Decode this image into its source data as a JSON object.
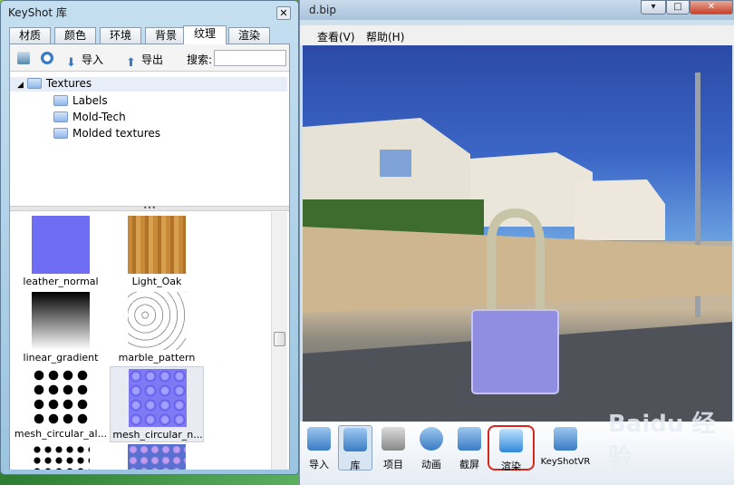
{
  "library": {
    "title": "KeyShot 库",
    "tabs": [
      "材质",
      "颜色",
      "环境",
      "背景",
      "纹理",
      "渲染"
    ],
    "active_tab": "纹理",
    "toolbar": {
      "import_label": "导入",
      "export_label": "导出",
      "search_label": "搜索:",
      "search_value": ""
    },
    "tree": {
      "root": "Textures",
      "children": [
        "Labels",
        "Mold-Tech",
        "Molded textures"
      ]
    },
    "thumbnails": [
      {
        "name": "leather_normal",
        "icon": "leather-normal-swatch"
      },
      {
        "name": "Light_Oak",
        "icon": "oak-wood-swatch"
      },
      {
        "name": "linear_gradient",
        "icon": "gradient-swatch"
      },
      {
        "name": "marble_pattern",
        "icon": "marble-swatch"
      },
      {
        "name": "mesh_circular_al...",
        "icon": "circle-mesh-swatch"
      },
      {
        "name": "mesh_circular_n...",
        "icon": "circle-normal-swatch"
      }
    ]
  },
  "main": {
    "title_fragment": "d.bip",
    "menu": [
      "查看(V)",
      "帮助(H)"
    ],
    "toolbar": [
      "导入",
      "库",
      "项目",
      "动画",
      "截屏",
      "渲染",
      "KeyShotVR"
    ],
    "active_tool": "库",
    "highlighted_tool": "渲染"
  },
  "watermark": "Baidu 经验",
  "colors": {
    "accent": "#3a7cc4",
    "highlight_ring": "#d9261c"
  }
}
